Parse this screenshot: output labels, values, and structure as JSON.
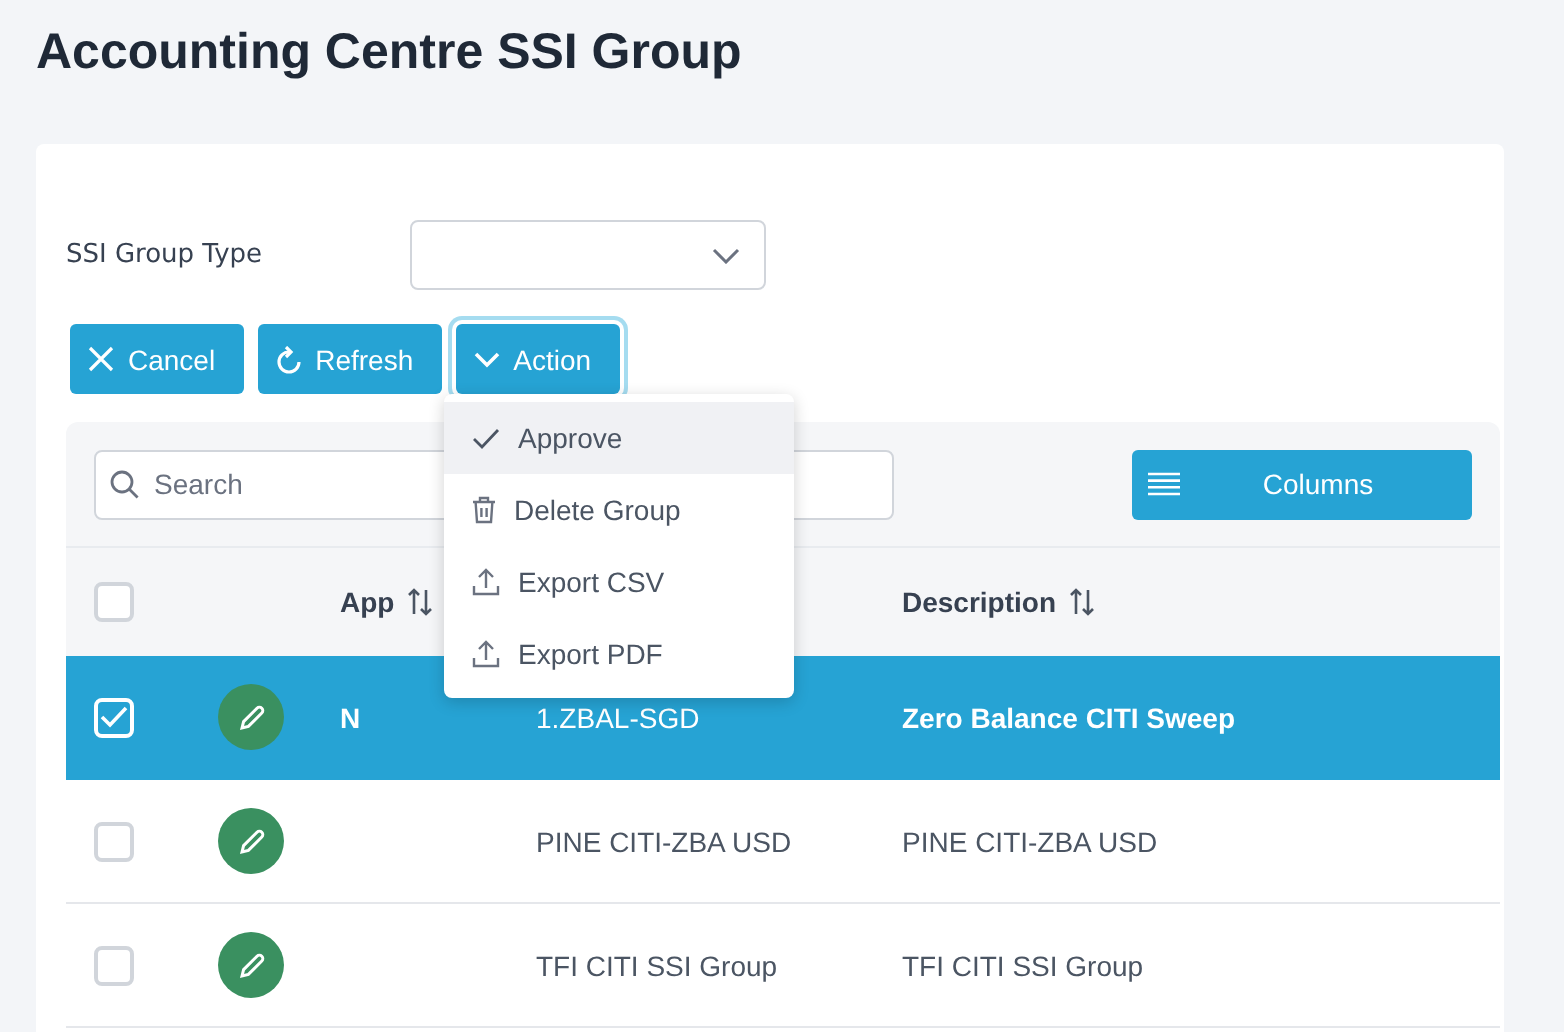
{
  "page_title": "Accounting Centre SSI Group",
  "filter": {
    "label": "SSI Group Type"
  },
  "buttons": [
    {
      "label": "Cancel",
      "kind": "close",
      "focused": false
    },
    {
      "label": "Refresh",
      "kind": "refresh",
      "focused": false
    },
    {
      "label": "Action",
      "kind": "dropdown",
      "focused": true
    }
  ],
  "action_menu": [
    {
      "label": "Approve",
      "kind": "approve",
      "selected": true
    },
    {
      "label": "Delete Group",
      "kind": "delete",
      "selected": false
    },
    {
      "label": "Export CSV",
      "kind": "export",
      "selected": false
    },
    {
      "label": "Export PDF",
      "kind": "export",
      "selected": false
    }
  ],
  "search": {
    "placeholder": "Search"
  },
  "columns_button": {
    "label": "Columns"
  },
  "table": {
    "select_all_checked": false,
    "columns": [
      {
        "label": "App"
      },
      {
        "label": "Description"
      }
    ],
    "rows": [
      {
        "selected": true,
        "app": "N",
        "group": "1.ZBAL-SGD",
        "description": "Zero Balance CITI Sweep"
      },
      {
        "selected": false,
        "group": "PINE CITI-ZBA USD",
        "description": "PINE CITI-ZBA USD"
      },
      {
        "selected": false,
        "group": "TFI CITI SSI Group",
        "description": "TFI CITI SSI Group"
      }
    ]
  }
}
